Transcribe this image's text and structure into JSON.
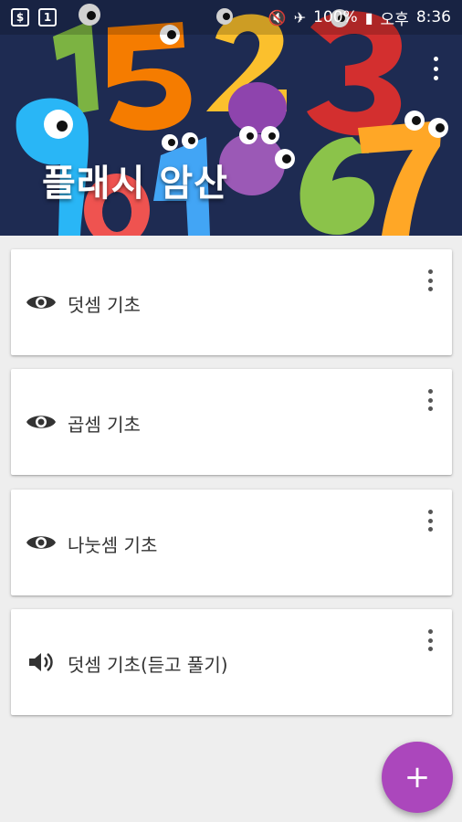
{
  "status_bar": {
    "battery": "100%",
    "ampm": "오후",
    "time": "8:36",
    "icons": [
      "sim-s-icon",
      "sim-1-icon",
      "mute-icon",
      "airplane-icon",
      "alarm-icon",
      "battery-icon"
    ]
  },
  "header": {
    "title": "플래시 암산",
    "menu_icon": "more-vert-icon",
    "background_color": "#1e2b52"
  },
  "items": [
    {
      "label": "덧셈 기초",
      "icon": "eye-icon"
    },
    {
      "label": "곱셈 기초",
      "icon": "eye-icon"
    },
    {
      "label": "나눗셈 기초",
      "icon": "eye-icon"
    },
    {
      "label": "덧셈 기초(듣고 풀기)",
      "icon": "speaker-icon"
    }
  ],
  "fab": {
    "symbol": "+",
    "color": "#ab47bc"
  }
}
